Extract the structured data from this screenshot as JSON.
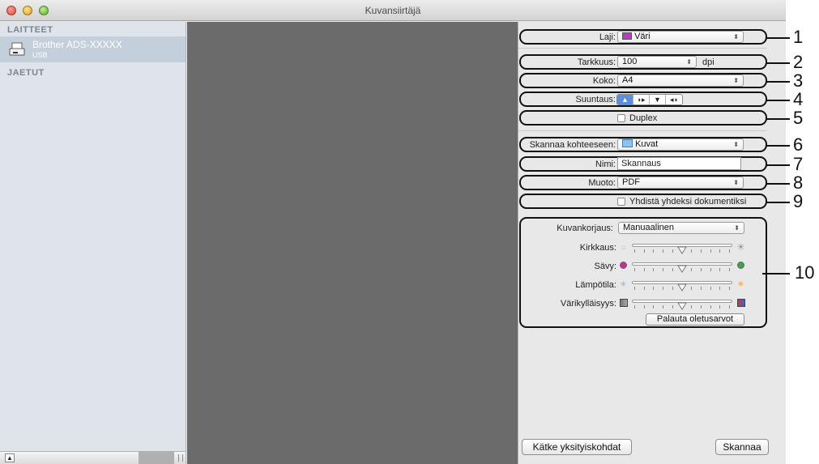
{
  "window": {
    "title": "Kuvansiirtäjä"
  },
  "sidebar": {
    "devices_header": "LAITTEET",
    "device": {
      "name": "Brother ADS-XXXXX",
      "connection": "USB"
    },
    "shared_header": "JAETUT"
  },
  "settings": {
    "laji": {
      "label": "Laji:",
      "value": "Väri"
    },
    "tarkkuus": {
      "label": "Tarkkuus:",
      "value": "100",
      "unit": "dpi"
    },
    "koko": {
      "label": "Koko:",
      "value": "A4"
    },
    "suuntaus": {
      "label": "Suuntaus:"
    },
    "duplex": {
      "label": "Duplex",
      "checked": false
    },
    "skannaa_kohteeseen": {
      "label": "Skannaa kohteeseen:",
      "value": "Kuvat"
    },
    "nimi": {
      "label": "Nimi:",
      "value": "Skannaus"
    },
    "muoto": {
      "label": "Muoto:",
      "value": "PDF"
    },
    "yhdista": {
      "label": "Yhdistä yhdeksi dokumentiksi",
      "checked": false
    },
    "kuvankorjaus": {
      "label": "Kuvankorjaus:",
      "value": "Manuaalinen"
    },
    "kirkkaus": {
      "label": "Kirkkaus:",
      "level": 0.5
    },
    "savy": {
      "label": "Sävy:",
      "level": 0.5
    },
    "lampotila": {
      "label": "Lämpötila:",
      "level": 0.5
    },
    "varikyllaisyys": {
      "label": "Värikylläisyys:",
      "level": 0.5
    },
    "reset_button": "Palauta oletusarvot"
  },
  "footer": {
    "hide_details_button": "Kätke yksityiskohdat",
    "scan_button": "Skannaa"
  },
  "callouts": [
    "1",
    "2",
    "3",
    "4",
    "5",
    "6",
    "7",
    "8",
    "9",
    "10"
  ]
}
